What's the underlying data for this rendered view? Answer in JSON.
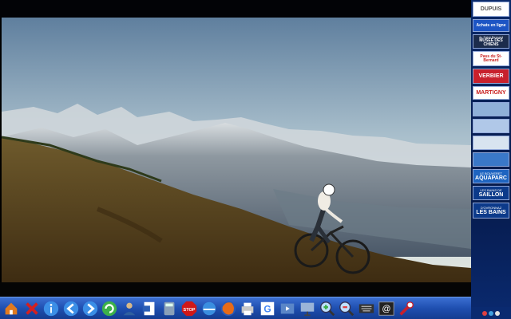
{
  "video": {
    "scene": "mountain-biker",
    "colors": {
      "sky_top": "#6f8fb0",
      "sky_bottom": "#dbe4e6",
      "grass": "#5a4320",
      "mountain": "#596a7a"
    }
  },
  "sidebar": {
    "items": [
      {
        "name": "dupuis-logo",
        "label": "DUPUIS",
        "sublabel": "",
        "bg": "#ffffff",
        "fg": "#555555"
      },
      {
        "name": "achats-en-ligne",
        "label": "Achats en ligne",
        "sublabel": "",
        "bg": "#1d55c4",
        "fg": "#ffffff"
      },
      {
        "name": "musee-des-chiens",
        "label": "MUSÉE DES CHIENS",
        "sublabel": "du Saint-Bernard",
        "bg": "#1c2c4c",
        "fg": "#ffffff"
      },
      {
        "name": "pass-st-bernard",
        "label": "Pass du St-Bernard",
        "sublabel": "",
        "bg": "#ffffff",
        "fg": "#c81d1d"
      },
      {
        "name": "verbier",
        "label": "VERBIER",
        "sublabel": "",
        "bg": "#c8202c",
        "fg": "#ffffff"
      },
      {
        "name": "martigny",
        "label": "MARTIGNY",
        "sublabel": "",
        "bg": "#ffffff",
        "fg": "#c81d1d"
      },
      {
        "name": "ad-7",
        "label": "",
        "sublabel": "",
        "bg": "#8fb0d8",
        "fg": "#ffffff"
      },
      {
        "name": "ad-8",
        "label": "",
        "sublabel": "",
        "bg": "#b0c8e8",
        "fg": "#ffffff"
      },
      {
        "name": "ad-9",
        "label": "",
        "sublabel": "",
        "bg": "#d8e4f0",
        "fg": "#ffffff"
      },
      {
        "name": "ad-10",
        "label": "",
        "sublabel": "",
        "bg": "#3a78c8",
        "fg": "#ffffff"
      },
      {
        "name": "aquaparc",
        "label": "AQUAPARC",
        "sublabel": "LE BOUVERET",
        "bg": "#1e64c0",
        "fg": "#ffffff"
      },
      {
        "name": "saillon",
        "label": "SAILLON",
        "sublabel": "LES BAINS DE",
        "bg": "#0c3a8a",
        "fg": "#ffffff"
      },
      {
        "name": "ovronnaz",
        "label": "LES BAINS",
        "sublabel": "D'OVRONNAZ",
        "bg": "#0c3a8a",
        "fg": "#ffffff"
      }
    ]
  },
  "taskbar": {
    "buttons": [
      {
        "name": "home",
        "icon": "home-icon",
        "color": "#e07a20"
      },
      {
        "name": "close",
        "icon": "close-x-icon",
        "color": "#d42020"
      },
      {
        "name": "info",
        "icon": "info-icon",
        "color": "#3b8ee6"
      },
      {
        "name": "back",
        "icon": "arrow-left-icon",
        "color": "#3b8ee6"
      },
      {
        "name": "forward",
        "icon": "arrow-right-icon",
        "color": "#3b8ee6"
      },
      {
        "name": "refresh",
        "icon": "refresh-icon",
        "color": "#3cb04a"
      },
      {
        "name": "user",
        "icon": "user-icon",
        "color": "#d8b888"
      },
      {
        "name": "word",
        "icon": "document-icon",
        "color": "#2b5eb6"
      },
      {
        "name": "calculator",
        "icon": "calculator-icon",
        "color": "#8aa0b8"
      },
      {
        "name": "stop",
        "icon": "stop-icon",
        "color": "#d01818"
      },
      {
        "name": "internet-explorer",
        "icon": "browser-icon",
        "color": "#3a8ee0"
      },
      {
        "name": "firefox",
        "icon": "firefox-icon",
        "color": "#e86b18"
      },
      {
        "name": "printer",
        "icon": "printer-icon",
        "color": "#c8c8c8"
      },
      {
        "name": "google",
        "icon": "google-icon",
        "color": "#ffffff"
      },
      {
        "name": "media",
        "icon": "media-icon",
        "color": "#5a86c8"
      },
      {
        "name": "presentation",
        "icon": "presentation-icon",
        "color": "#9ab4d8"
      },
      {
        "name": "zoom-in",
        "icon": "zoom-in-icon",
        "color": "#3cb04a"
      },
      {
        "name": "zoom-out",
        "icon": "zoom-out-icon",
        "color": "#e04040"
      },
      {
        "name": "keyboard",
        "icon": "keyboard-icon",
        "color": "#333333"
      },
      {
        "name": "email",
        "icon": "at-icon",
        "color": "#222222"
      },
      {
        "name": "signal",
        "icon": "signal-icon",
        "color": "#c8202c"
      }
    ]
  }
}
